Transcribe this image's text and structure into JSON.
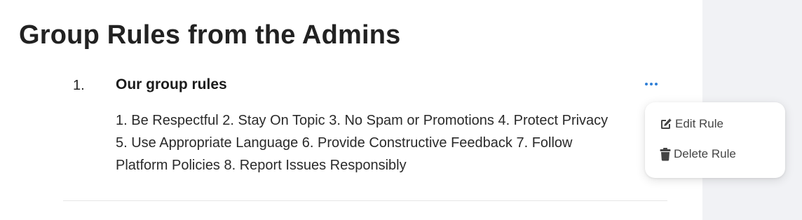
{
  "page": {
    "title": "Group Rules from the Admins"
  },
  "rule": {
    "number": "1.",
    "title": "Our group rules",
    "body": "1. Be Respectful 2. Stay On Topic 3. No Spam or Promotions 4. Protect Privacy 5. Use Appropriate Language 6. Provide Constructive Feedback 7. Follow Platform Policies 8. Report Issues Responsibly",
    "more_icon": "ellipsis-horizontal-icon"
  },
  "menu": {
    "edit_label": "Edit Rule",
    "edit_icon": "edit-icon",
    "delete_label": "Delete Rule",
    "delete_icon": "trash-icon"
  },
  "colors": {
    "accent": "#2f7fd6",
    "side_panel": "#f1f2f5",
    "text": "#222222",
    "menu_text": "#444444"
  }
}
